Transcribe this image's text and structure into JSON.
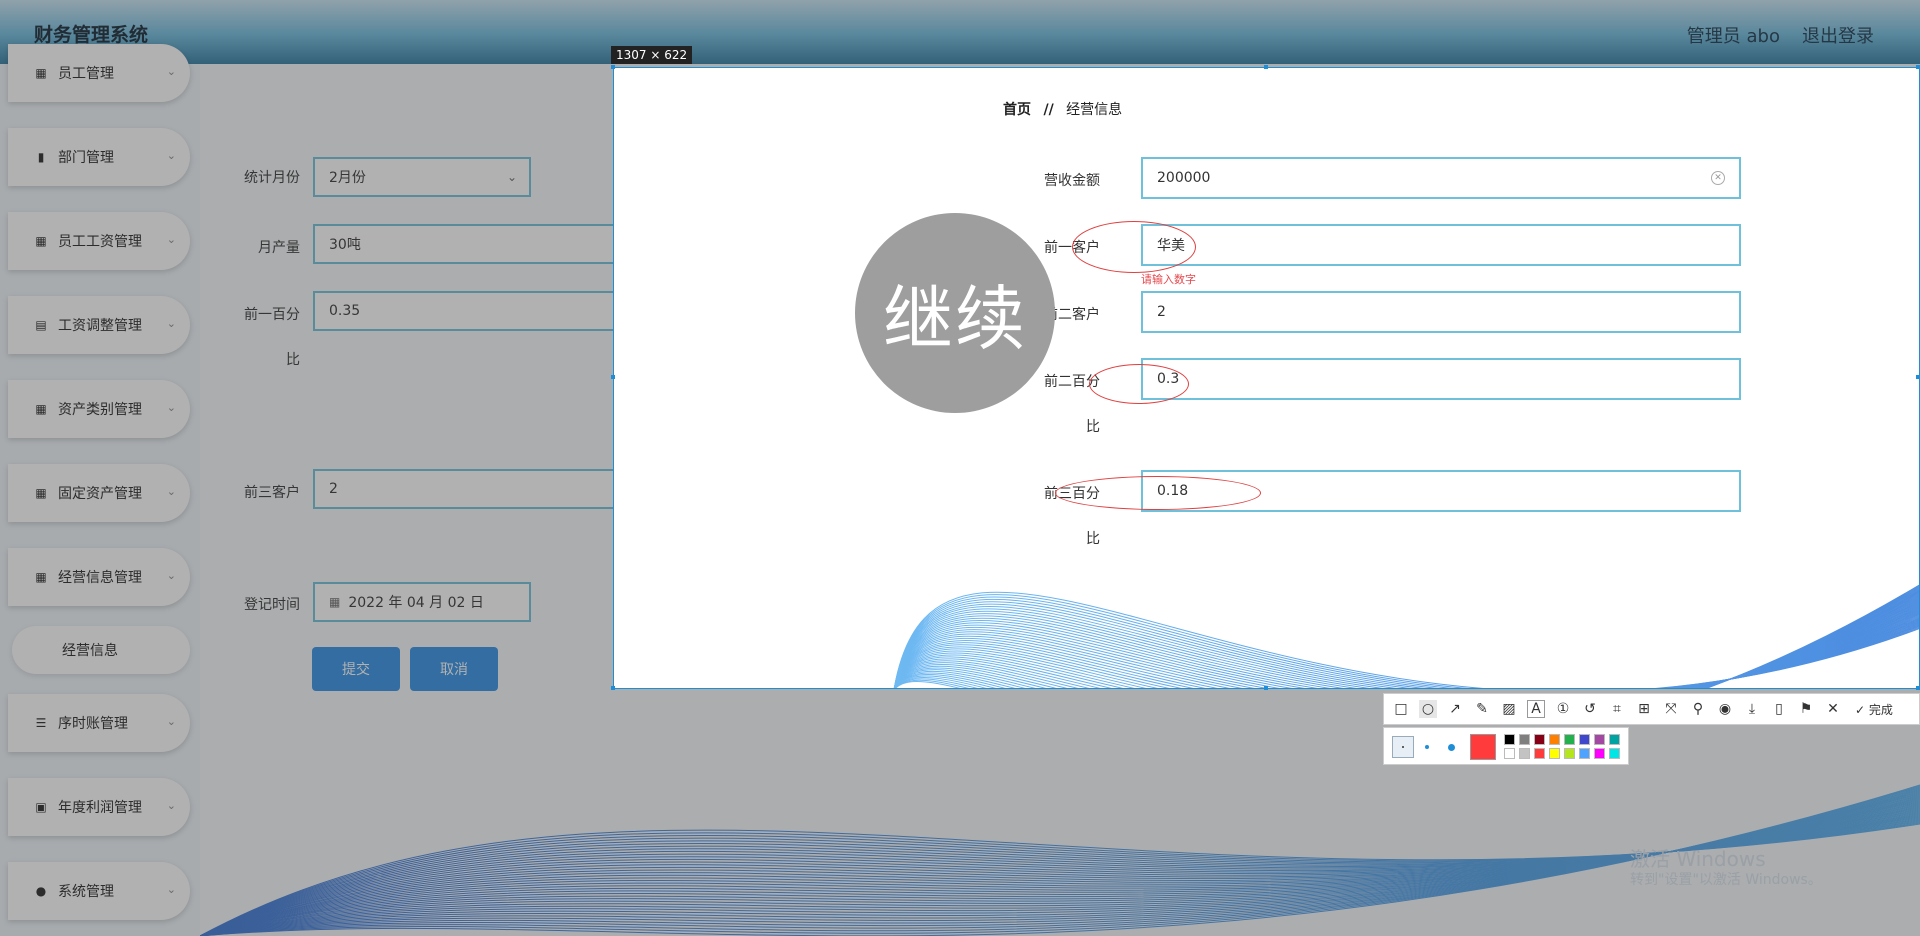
{
  "header": {
    "title": "财务管理系统",
    "user": "管理员 abo",
    "logout": "退出登录"
  },
  "sidebar": {
    "items": [
      {
        "label": "员工管理",
        "icon": "grid-icon"
      },
      {
        "label": "部门管理",
        "icon": "bar-chart-icon"
      },
      {
        "label": "员工工资管理",
        "icon": "grid-icon"
      },
      {
        "label": "工资调整管理",
        "icon": "clipboard-icon"
      },
      {
        "label": "资产类别管理",
        "icon": "grid-icon"
      },
      {
        "label": "固定资产管理",
        "icon": "grid-icon"
      },
      {
        "label": "经营信息管理",
        "icon": "grid-icon"
      },
      {
        "label": "序时账管理",
        "icon": "list-icon"
      },
      {
        "label": "年度利润管理",
        "icon": "clipboard-check-icon"
      },
      {
        "label": "系统管理",
        "icon": "user-icon"
      }
    ],
    "sub_item": "经营信息"
  },
  "left_form": {
    "month_label": "统计月份",
    "month_value": "2月份",
    "output_label": "月产量",
    "output_value": "30吨",
    "top1_pct_label_1": "前一百分",
    "top1_pct_label_2": "比",
    "top1_pct_value": "0.35",
    "top3_client_label": "前三客户",
    "top3_client_value": "2",
    "date_label": "登记时间",
    "date_value": "2022 年 04 月 02 日",
    "submit": "提交",
    "cancel": "取消"
  },
  "selection": {
    "size": "1307 × 622",
    "breadcrumb_home": "首页",
    "breadcrumb_sep": "//",
    "breadcrumb_current": "经营信息",
    "revenue_label": "营收金额",
    "revenue_value": "200000",
    "client1_label": "前一客户",
    "client1_value": "华美",
    "client1_error": "请输入数字",
    "client2_label": "前二客户",
    "client2_value": "2",
    "pct2_label_1": "前二百分",
    "pct2_label_2": "比",
    "pct2_value": "0.3",
    "pct3_label_1": "前三百分",
    "pct3_label_2": "比",
    "pct3_value": "0.18"
  },
  "continue_text": "继续",
  "toolbar": {
    "tools": [
      "rectangle-icon",
      "ellipse-icon",
      "arrow-icon",
      "pen-icon",
      "mosaic-icon",
      "text-icon",
      "number-icon",
      "undo-icon",
      "ocr-icon",
      "translate-icon",
      "scroll-capture-icon",
      "pin-icon",
      "record-icon",
      "download-icon",
      "copy-icon",
      "bookmark-icon",
      "close-icon"
    ],
    "done": "完成"
  },
  "palette": {
    "current": "#ff3b3b",
    "colors": [
      "#000000",
      "#7f7f7f",
      "#880015",
      "#ff8000",
      "#22b14c",
      "#3f48cc",
      "#a349a4",
      "#00a2a2",
      "#ffffff",
      "#c3c3c3",
      "#ff3b3b",
      "#ffff00",
      "#b5e61d",
      "#4fa3ff",
      "#ff00ff",
      "#00e5e5"
    ]
  },
  "watermark": {
    "line1": "激活 Windows",
    "line2": "转到\"设置\"以激活 Windows。"
  }
}
